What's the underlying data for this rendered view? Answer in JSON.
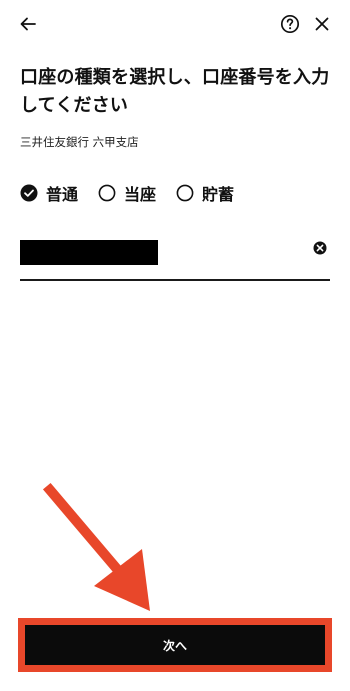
{
  "header": {
    "back_icon": "arrow-left-icon",
    "help_icon": "question-circle-icon",
    "close_icon": "close-icon"
  },
  "title": "口座の種類を選択し、口座番号を入力してください",
  "bank_branch": "三井住友銀行 六甲支店",
  "account_types": [
    {
      "label": "普通",
      "selected": true
    },
    {
      "label": "当座",
      "selected": false
    },
    {
      "label": "貯蓄",
      "selected": false
    }
  ],
  "account_number": {
    "value_masked": true,
    "clear_icon": "clear-circle-icon"
  },
  "next_button": {
    "label": "次へ"
  },
  "annotation": {
    "arrow_color": "#e8472a",
    "highlight_color": "#e8472a"
  }
}
